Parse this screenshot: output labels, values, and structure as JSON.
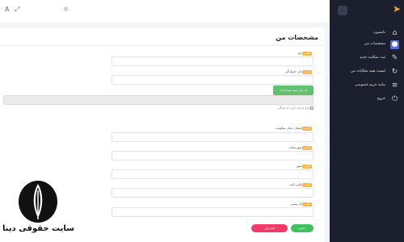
{
  "topbar": {
    "left_icons": [
      "user-icon",
      "expand-icon"
    ],
    "theme_icon": "sun-icon"
  },
  "sidebar": {
    "items": [
      {
        "label": "داشبورد",
        "icon": "home-icon"
      },
      {
        "label": "مشخصات من",
        "icon": "user-icon"
      },
      {
        "label": "ثبت شکایت جدید",
        "icon": "edit-icon"
      },
      {
        "label": "لیست همه شکایات من",
        "icon": "refresh-icon"
      },
      {
        "label": "بیانیه حریم خصوصی",
        "icon": "list-icon"
      },
      {
        "label": "خروج",
        "icon": "power-icon"
      }
    ],
    "active_index": 1
  },
  "main": {
    "title": "مشخصات من",
    "fields": [
      {
        "label": "نام",
        "required": true,
        "value": ""
      },
      {
        "label": "نام خانوادگی",
        "required": true,
        "value": ""
      },
      {
        "label": "کد ملی",
        "required": true,
        "value": ""
      },
      {
        "label": "استان محل سکونت",
        "required": true,
        "value": ""
      },
      {
        "label": "شهرستان",
        "required": true,
        "value": ""
      },
      {
        "label": "شهر",
        "required": true,
        "value": ""
      },
      {
        "label": "تلفن ثابت",
        "required": true,
        "value": ""
      },
      {
        "label": "کد پستی",
        "required": true,
        "value": ""
      }
    ],
    "required_badge": "الزامی",
    "national_id_note": "اتباع خارجه دارای کد فراگیر",
    "green_notice": "کد ملی تایید شده است",
    "save_label": "ذخیره",
    "cancel_label": "انصراف"
  },
  "watermark": {
    "text": "سایت حقوقی دینا"
  },
  "colors": {
    "sidebar_bg": "#1c1f2e",
    "accent": "#5b6bd6",
    "brand": "#e6a23c",
    "save": "#3fbf5f",
    "cancel": "#ef3a6a",
    "notice": "#63c06e",
    "badge": "#f6b24a"
  }
}
